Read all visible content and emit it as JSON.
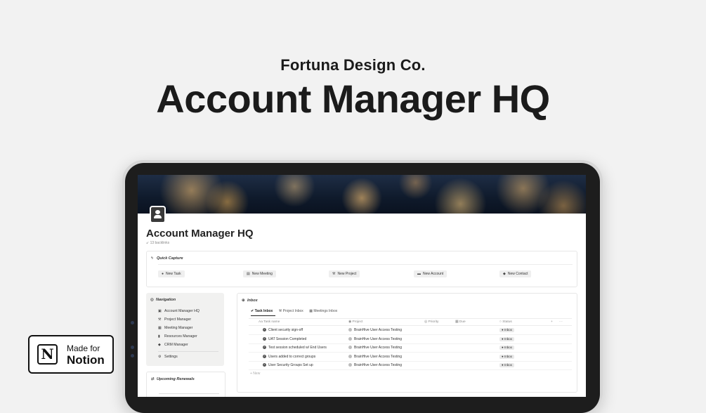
{
  "hero": {
    "subtitle": "Fortuna Design Co.",
    "title": "Account Manager HQ"
  },
  "page": {
    "title": "Account Manager HQ",
    "backlinks": "↙ 13 backlinks"
  },
  "quick_capture": {
    "heading": "Quick Capture",
    "heading_icon": "lightning-icon",
    "buttons": [
      {
        "label": "New Task",
        "icon": "check-circle-icon"
      },
      {
        "label": "New Meeting",
        "icon": "document-icon"
      },
      {
        "label": "New Project",
        "icon": "hammer-icon"
      },
      {
        "label": "New Account",
        "icon": "briefcase-icon"
      },
      {
        "label": "New Contact",
        "icon": "tag-icon"
      }
    ]
  },
  "navigation": {
    "heading": "Navigation",
    "heading_icon": "compass-icon",
    "items": [
      {
        "label": "Account Manager HQ",
        "icon": "badge-icon"
      },
      {
        "label": "Project Manager",
        "icon": "hammer-icon"
      },
      {
        "label": "Meeting Manager",
        "icon": "calendar-icon"
      },
      {
        "label": "Resources Manager",
        "icon": "bookmark-icon"
      },
      {
        "label": "CRM Manager",
        "icon": "tag-icon"
      }
    ],
    "settings": {
      "label": "Settings",
      "icon": "gear-icon"
    }
  },
  "upcoming_renewals": {
    "heading": "Upcoming Renewals",
    "heading_icon": "repeat-icon"
  },
  "inbox": {
    "heading": "Inbox",
    "heading_icon": "globe-icon",
    "tabs": [
      {
        "label": "Task Inbox",
        "active": true
      },
      {
        "label": "Project Inbox",
        "active": false
      },
      {
        "label": "Meetings Inbox",
        "active": false
      }
    ],
    "columns": [
      "Task name",
      "Project",
      "Priority",
      "Due",
      "Status"
    ],
    "rows": [
      {
        "task": "Client security sign-off",
        "project": "BrainHive User Access Testing",
        "status": "Inbox"
      },
      {
        "task": "UAT Session Completed",
        "project": "BrainHive User Access Testing",
        "status": "Inbox"
      },
      {
        "task": "Test session scheduled w/ End Users",
        "project": "BrainHive User Access Testing",
        "status": "Inbox"
      },
      {
        "task": "Users added to correct groups",
        "project": "BrainHive User Access Testing",
        "status": "Inbox"
      },
      {
        "task": "User Security Groups Set up",
        "project": "BrainHive User Access Testing",
        "status": "Inbox"
      }
    ],
    "new_label": "+ New"
  },
  "badge": {
    "logo_letter": "N",
    "made_for": "Made for",
    "brand": "Notion"
  },
  "colors": {
    "background": "#f2f2f2",
    "text": "#1b1b1b",
    "tablet_frame": "#d7d7d7"
  }
}
